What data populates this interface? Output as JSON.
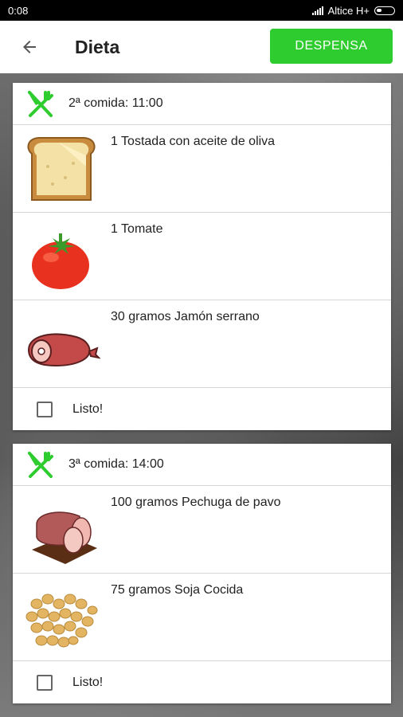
{
  "status_bar": {
    "time": "0:08",
    "carrier": "Altice H+"
  },
  "appbar": {
    "title": "Dieta",
    "despensa_label": "DESPENSA"
  },
  "meals": [
    {
      "title": "2ª comida: 11:00",
      "foods": [
        {
          "text": "1   Tostada con aceite de oliva",
          "icon": "toast-icon"
        },
        {
          "text": "1   Tomate",
          "icon": "tomato-icon"
        },
        {
          "text": "30 gramos Jamón serrano",
          "icon": "ham-icon"
        }
      ],
      "done_label": "Listo!",
      "done": false
    },
    {
      "title": "3ª comida: 14:00",
      "foods": [
        {
          "text": "100 gramos Pechuga de pavo",
          "icon": "turkey-breast-icon"
        },
        {
          "text": "75 gramos Soja Cocida",
          "icon": "soybeans-icon"
        }
      ],
      "done_label": "Listo!",
      "done": false
    }
  ],
  "colors": {
    "accent": "#2ecc2e",
    "fork_icon": "#2ecc2e"
  }
}
